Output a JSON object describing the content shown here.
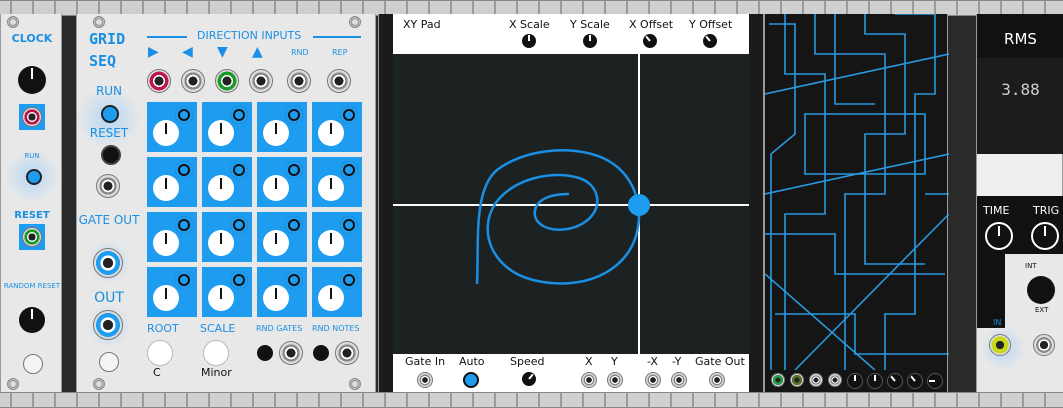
{
  "clock_module": {
    "title": "CLOCK",
    "run_label": "RUN",
    "reset_label": "RESET",
    "random_reset_label": "RANDOM RESET"
  },
  "grid_seq": {
    "title_line1": "GRID",
    "title_line2": "SEQ",
    "direction_inputs_label": "DIRECTION INPUTS",
    "direction_arrows": [
      "▶",
      "◀",
      "▼",
      "▲"
    ],
    "rnd_label": "RND",
    "rep_label": "REP",
    "run_label": "RUN",
    "reset_label": "RESET",
    "gate_out_label": "GATE OUT",
    "out_label": "OUT",
    "root_label": "ROOT",
    "scale_label": "SCALE",
    "root_value": "C",
    "scale_value": "Minor",
    "rnd_gates_label": "RND GATES",
    "rnd_notes_label": "RND NOTES"
  },
  "xy_pad": {
    "title": "XY Pad",
    "x_scale_label": "X Scale",
    "y_scale_label": "Y Scale",
    "x_offset_label": "X Offset",
    "y_offset_label": "Y Offset",
    "gate_in_label": "Gate In",
    "auto_label": "Auto",
    "speed_label": "Speed",
    "x_label": "X",
    "y_label": "Y",
    "neg_x_label": "-X",
    "neg_y_label": "-Y",
    "gate_out_label": "Gate Out",
    "accent_color": "#1a8fe3"
  },
  "rms": {
    "title": "RMS",
    "value": "3.88",
    "time_label": "TIME",
    "trig_label": "TRIG",
    "int_label": "INT",
    "ext_label": "EXT",
    "in_label": "IN"
  }
}
